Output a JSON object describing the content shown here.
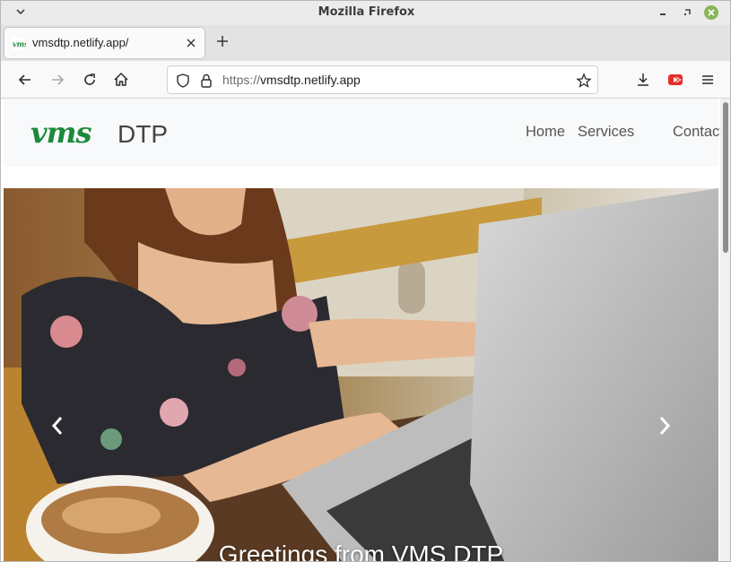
{
  "window": {
    "title": "Mozilla Firefox"
  },
  "tab": {
    "title": "vmsdtp.netlify.app/",
    "favicon_text": "vms"
  },
  "urlbar": {
    "scheme": "https://",
    "host": "vmsdtp.netlify.app"
  },
  "icons": {
    "window_menu": "chevron-down-icon",
    "minimize": "minimize-icon",
    "maximize": "maximize-icon",
    "close": "close-icon",
    "tab_close": "close-icon",
    "new_tab": "plus-icon",
    "back": "arrow-left-icon",
    "forward": "arrow-right-icon",
    "reload": "reload-icon",
    "home": "home-icon",
    "shield": "shield-icon",
    "lock": "lock-icon",
    "bookmark": "star-icon",
    "downloads": "download-icon",
    "extension": "youtube-extension-icon",
    "menu": "hamburger-icon",
    "carousel_prev": "chevron-left-icon",
    "carousel_next": "chevron-right-icon"
  },
  "site": {
    "logo_mark": "vms",
    "logo_text": "DTP",
    "nav": [
      "Home",
      "Services",
      "Contact"
    ],
    "hero_caption": "Greetings from VMS DTP"
  },
  "colors": {
    "brand_green": "#1b8a3a",
    "close_button": "#8ab55a",
    "extension_red": "#e52d27"
  }
}
